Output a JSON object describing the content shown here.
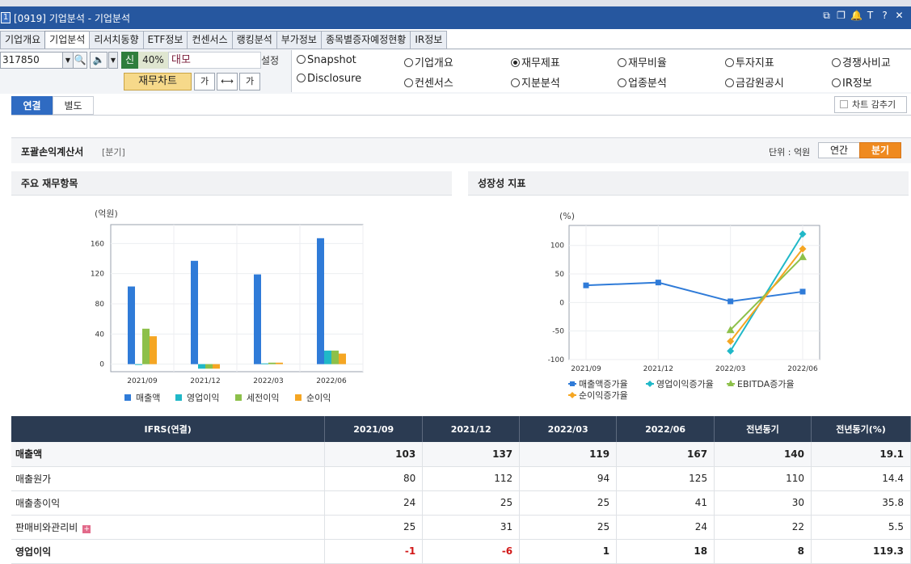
{
  "window": {
    "number": "1",
    "title": "[0919] 기업분석 - 기업분석",
    "controls": [
      "⧉",
      "❐",
      "🔔",
      "T",
      "?",
      "✕"
    ]
  },
  "tabs": [
    "기업개요",
    "기업분석",
    "리서치동향",
    "ETF정보",
    "컨센서스",
    "랭킹분석",
    "부가정보",
    "종목별증자예정현황",
    "IR정보"
  ],
  "toolbar": {
    "code": "317850",
    "shin": "신",
    "percent": "40%",
    "stock_name": "대모",
    "setting_label": "설정",
    "chart_button": "재무차트",
    "font_up": "가",
    "font_down": "가"
  },
  "radios": [
    {
      "label": "Snapshot",
      "selected": false
    },
    {
      "label": "기업개요",
      "selected": false
    },
    {
      "label": "재무제표",
      "selected": true
    },
    {
      "label": "재무비율",
      "selected": false
    },
    {
      "label": "투자지표",
      "selected": false
    },
    {
      "label": "경쟁사비교",
      "selected": false
    },
    {
      "label": "Disclosure",
      "selected": false
    },
    {
      "label": "컨센서스",
      "selected": false
    },
    {
      "label": "지분분석",
      "selected": false
    },
    {
      "label": "업종분석",
      "selected": false
    },
    {
      "label": "금감원공시",
      "selected": false
    },
    {
      "label": "IR정보",
      "selected": false
    }
  ],
  "subtabs": [
    "연결",
    "별도"
  ],
  "hide_chart_label": "차트 감추기",
  "section": {
    "title": "포괄손익계산서",
    "period_label": "[분기]",
    "unit_label": "단위 : 억원",
    "toggle_annual": "연간",
    "toggle_quarter": "분기"
  },
  "panel_left": {
    "title": "주요 재무항목"
  },
  "panel_right": {
    "title": "성장성 지표"
  },
  "chart_data": [
    {
      "type": "bar",
      "ylabel": "(억원)",
      "categories": [
        "2021/09",
        "2021/12",
        "2022/03",
        "2022/06"
      ],
      "yticks": [
        0,
        40,
        80,
        120,
        160
      ],
      "ylim": [
        -10,
        185
      ],
      "series": [
        {
          "name": "매출액",
          "color": "#2f7bd8",
          "values": [
            103,
            137,
            119,
            167
          ]
        },
        {
          "name": "영업이익",
          "color": "#20b8c8",
          "values": [
            -1,
            -6,
            1,
            18
          ]
        },
        {
          "name": "세전이익",
          "color": "#8dc04a",
          "values": [
            47,
            -6,
            2,
            18
          ]
        },
        {
          "name": "순이익",
          "color": "#f5a623",
          "values": [
            37,
            -6,
            2,
            14
          ]
        }
      ]
    },
    {
      "type": "line",
      "ylabel": "(%)",
      "categories": [
        "2021/09",
        "2021/12",
        "2022/03",
        "2022/06"
      ],
      "yticks": [
        -100,
        -50,
        0,
        50,
        100
      ],
      "ylim": [
        -100,
        135
      ],
      "series": [
        {
          "name": "매출액증가율",
          "color": "#2f7bd8",
          "marker": "square",
          "values": [
            30,
            35,
            2,
            19
          ]
        },
        {
          "name": "영업이익증가율",
          "color": "#20b8c8",
          "marker": "diamond",
          "values": [
            null,
            null,
            -85,
            120
          ]
        },
        {
          "name": "EBITDA증가율",
          "color": "#8dc04a",
          "marker": "triangle",
          "values": [
            null,
            null,
            -48,
            80
          ]
        },
        {
          "name": "순이익증가율",
          "color": "#f5a623",
          "marker": "diamond",
          "values": [
            null,
            null,
            -68,
            94
          ]
        }
      ]
    }
  ],
  "table": {
    "headers": [
      "IFRS(연결)",
      "2021/09",
      "2021/12",
      "2022/03",
      "2022/06",
      "전년동기",
      "전년동기(%)"
    ],
    "rows": [
      {
        "label": "매출액",
        "values": [
          "103",
          "137",
          "119",
          "167",
          "140",
          "19.1"
        ],
        "bold": true
      },
      {
        "label": "매출원가",
        "values": [
          "80",
          "112",
          "94",
          "125",
          "110",
          "14.4"
        ],
        "bold": false
      },
      {
        "label": "매출총이익",
        "values": [
          "24",
          "25",
          "25",
          "41",
          "30",
          "35.8"
        ],
        "bold": false
      },
      {
        "label": "판매비와관리비",
        "values": [
          "25",
          "31",
          "25",
          "24",
          "22",
          "5.5"
        ],
        "bold": false,
        "expand": true
      },
      {
        "label": "영업이익",
        "values": [
          "-1",
          "-6",
          "1",
          "18",
          "8",
          "119.3"
        ],
        "bold": true
      }
    ]
  }
}
